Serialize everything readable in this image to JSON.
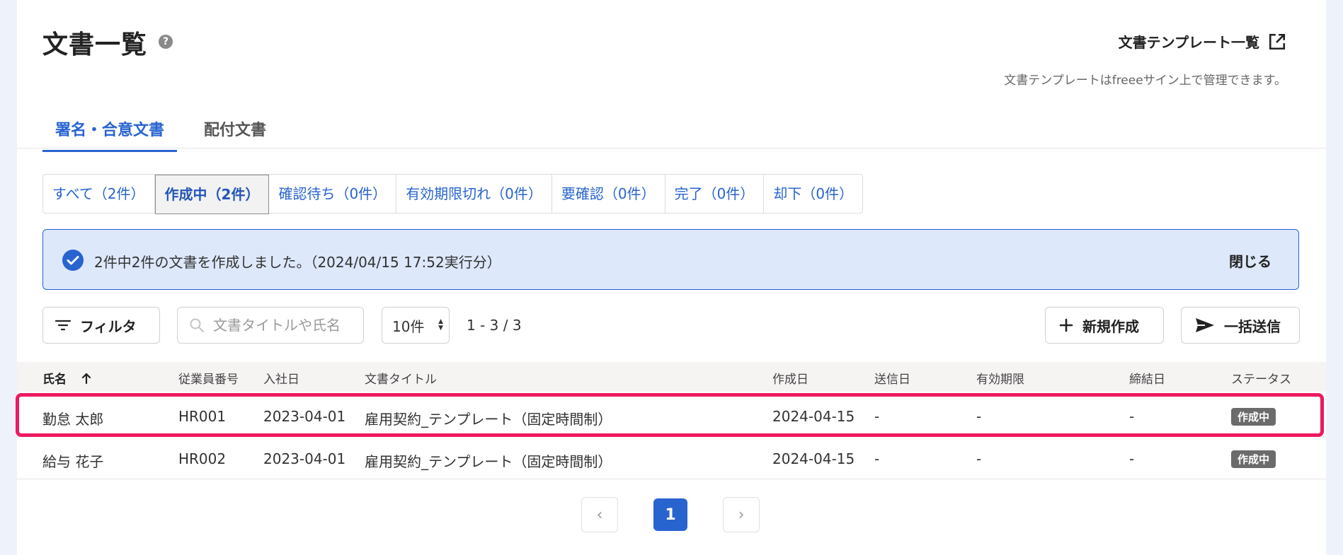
{
  "page": {
    "title": "文書一覧",
    "help_icon": "?",
    "template_link": "文書テンプレート一覧",
    "template_note": "文書テンプレートはfreeeサイン上で管理できます。"
  },
  "tabs": [
    {
      "label": "署名・合意文書",
      "active": true
    },
    {
      "label": "配付文書",
      "active": false
    }
  ],
  "status_filters": [
    {
      "label": "すべて（2件）",
      "active": false
    },
    {
      "label": "作成中（2件）",
      "active": true
    },
    {
      "label": "確認待ち（0件）",
      "active": false
    },
    {
      "label": "有効期限切れ（0件）",
      "active": false
    },
    {
      "label": "要確認（0件）",
      "active": false
    },
    {
      "label": "完了（0件）",
      "active": false
    },
    {
      "label": "却下（0件）",
      "active": false
    }
  ],
  "alert": {
    "message": "2件中2件の文書を作成しました。（2024/04/15 17:52実行分）",
    "close_label": "閉じる"
  },
  "toolbar": {
    "filter_label": "フィルタ",
    "search_placeholder": "文書タイトルや氏名",
    "page_size": "10件",
    "range": "1 - 3 / 3",
    "new_label": "新規作成",
    "bulk_send_label": "一括送信"
  },
  "table": {
    "headers": {
      "name": "氏名",
      "employee_no": "従業員番号",
      "join_date": "入社日",
      "doc_title": "文書タイトル",
      "created": "作成日",
      "sent": "送信日",
      "expiry": "有効期限",
      "concluded": "締結日",
      "status": "ステータス"
    },
    "rows": [
      {
        "name": "勤怠 太郎",
        "employee_no": "HR001",
        "join_date": "2023-04-01",
        "doc_title": "雇用契約_テンプレート（固定時間制）",
        "created": "2024-04-15",
        "sent": "-",
        "expiry": "-",
        "concluded": "-",
        "status": "作成中"
      },
      {
        "name": "給与 花子",
        "employee_no": "HR002",
        "join_date": "2023-04-01",
        "doc_title": "雇用契約_テンプレート（固定時間制）",
        "created": "2024-04-15",
        "sent": "-",
        "expiry": "-",
        "concluded": "-",
        "status": "作成中"
      }
    ]
  },
  "pagination": {
    "prev": "‹",
    "current": "1",
    "next": "›"
  },
  "colors": {
    "accent": "#2864d0",
    "highlight": "#ec1a5e",
    "badge": "#6b6b6b"
  }
}
